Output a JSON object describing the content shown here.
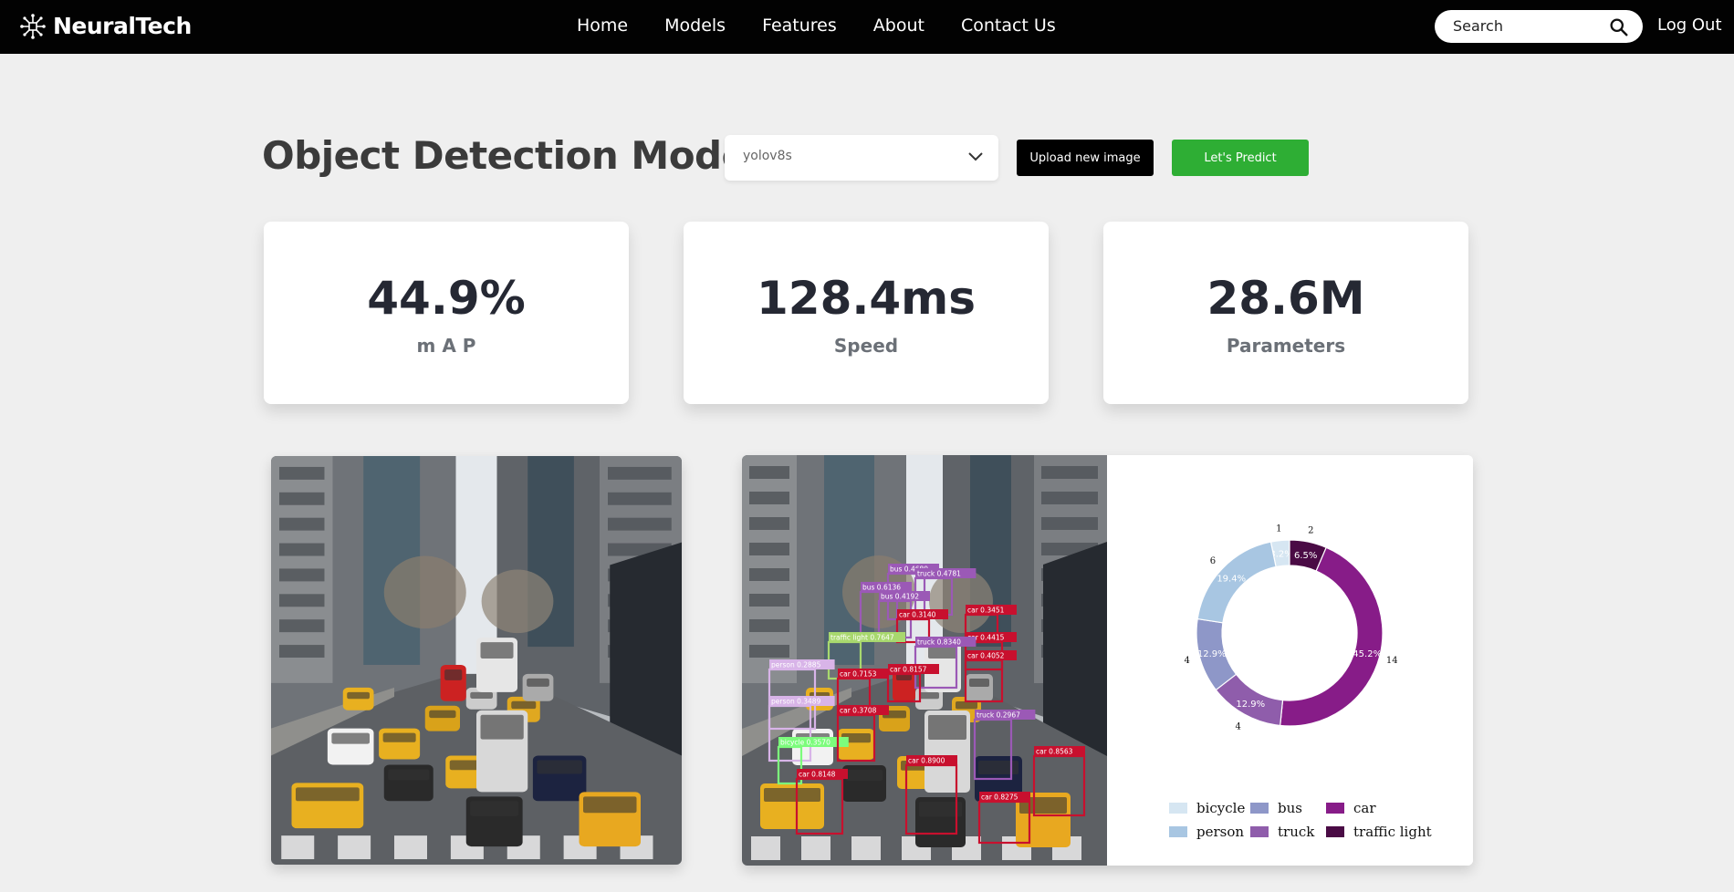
{
  "nav": {
    "brand": "NeuralTech",
    "links": [
      "Home",
      "Models",
      "Features",
      "About",
      "Contact Us"
    ],
    "search_placeholder": "Search",
    "logout": "Log Out"
  },
  "header": {
    "title": "Object Detection Model",
    "model_select_value": "yolov8s",
    "upload_label": "Upload new image",
    "predict_label": "Let's Predict"
  },
  "stats": [
    {
      "value": "44.9%",
      "label": "m A P"
    },
    {
      "value": "128.4ms",
      "label": "Speed"
    },
    {
      "value": "28.6M",
      "label": "Parameters"
    }
  ],
  "detections": [
    {
      "label": "bus 0.4680",
      "color": "#9b59b6"
    },
    {
      "label": "truck 0.4781",
      "color": "#9b59b6"
    },
    {
      "label": "bus 0.6136",
      "color": "#9b59b6"
    },
    {
      "label": "bus 0.4192",
      "color": "#9b59b6"
    },
    {
      "label": "car 0.3451",
      "color": "#c8102e"
    },
    {
      "label": "car 0.3140",
      "color": "#c8102e"
    },
    {
      "label": "traffic light 0.7647",
      "color": "#a8d86e"
    },
    {
      "label": "car 0.4415",
      "color": "#c8102e"
    },
    {
      "label": "truck 0.8340",
      "color": "#9b59b6"
    },
    {
      "label": "car 0.4052",
      "color": "#c8102e"
    },
    {
      "label": "person 0.2885",
      "color": "#d8b4e8"
    },
    {
      "label": "car 0.7153",
      "color": "#c8102e"
    },
    {
      "label": "car 0.8157",
      "color": "#c8102e"
    },
    {
      "label": "person 0.3489",
      "color": "#d8b4e8"
    },
    {
      "label": "bicycle 0.3570",
      "color": "#7cfc7c"
    },
    {
      "label": "car 0.3708",
      "color": "#c8102e"
    },
    {
      "label": "truck 0.2967",
      "color": "#9b59b6"
    },
    {
      "label": "car 0.8900",
      "color": "#c8102e"
    },
    {
      "label": "car 0.8563",
      "color": "#c8102e"
    },
    {
      "label": "car 0.8275",
      "color": "#c8102e"
    },
    {
      "label": "car 0.8148",
      "color": "#c8102e"
    }
  ],
  "chart_data": {
    "type": "pie",
    "donut": true,
    "categories": [
      "bicycle",
      "traffic light",
      "car",
      "truck",
      "bus",
      "person"
    ],
    "values": [
      1,
      2,
      14,
      4,
      4,
      6
    ],
    "percent_labels": [
      "3.2%",
      "6.5%",
      "45.2%",
      "12.9%",
      "12.9%",
      "19.4%"
    ],
    "colors": [
      "#d6e6f2",
      "#4a0b45",
      "#871c88",
      "#8f5dab",
      "#8e97c8",
      "#a8c6e2"
    ],
    "legend_order": [
      "bicycle",
      "bus",
      "car",
      "person",
      "truck",
      "traffic light"
    ],
    "legend_placement": "bottom"
  }
}
